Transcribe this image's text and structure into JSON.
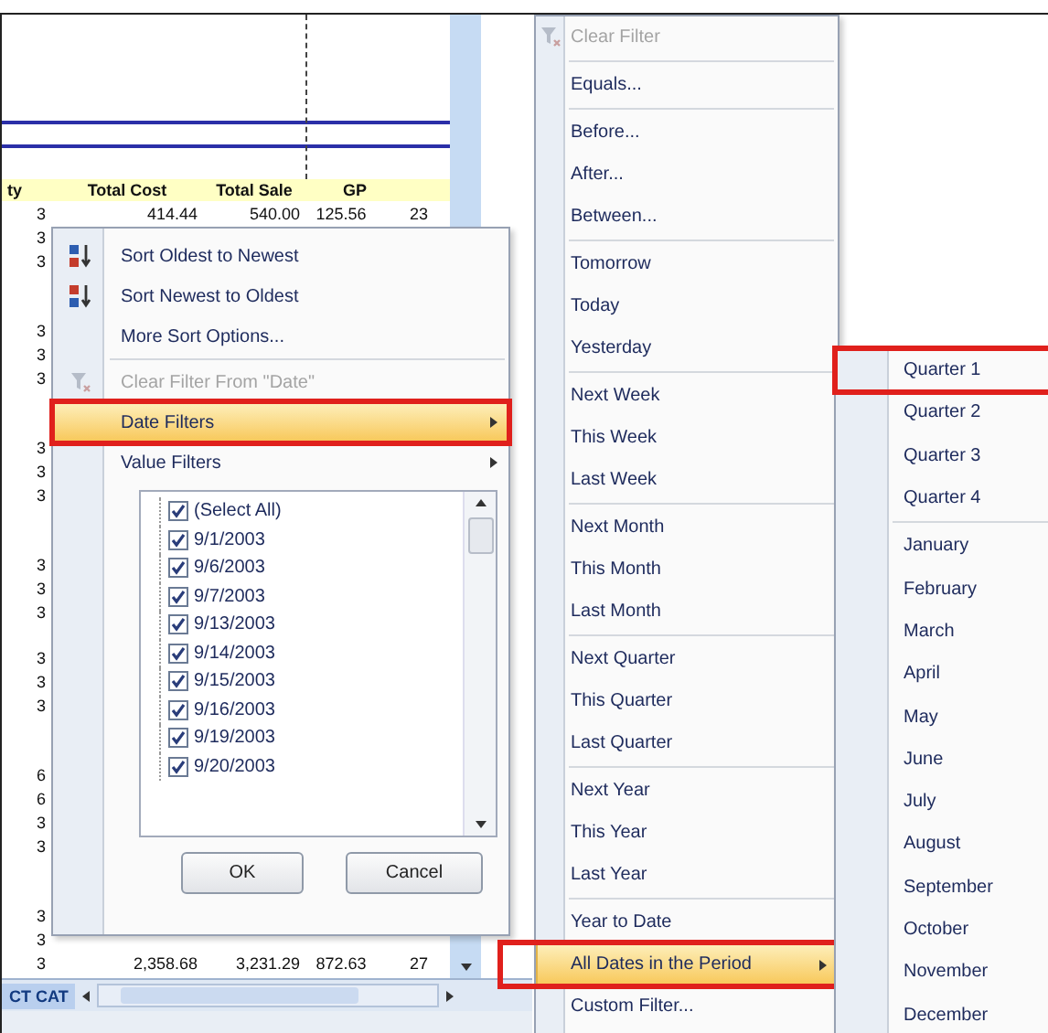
{
  "sheet": {
    "columns": [
      "ty",
      "Total Cost",
      "Total Sale",
      "GP"
    ],
    "first_row": [
      "3",
      "414.44",
      "540.00",
      "125.56",
      "23"
    ],
    "qty_rows": [
      {
        "kind": "value",
        "qty": "3"
      },
      {
        "kind": "value",
        "qty": "3"
      },
      {
        "kind": "empty"
      },
      {
        "kind": "empty"
      },
      {
        "kind": "value",
        "qty": "3"
      },
      {
        "kind": "value",
        "qty": "3"
      },
      {
        "kind": "value",
        "qty": "3"
      },
      {
        "kind": "empty"
      },
      {
        "kind": "empty"
      },
      {
        "kind": "value",
        "qty": "3"
      },
      {
        "kind": "value",
        "qty": "3"
      },
      {
        "kind": "value",
        "qty": "3"
      },
      {
        "kind": "empty"
      },
      {
        "kind": "empty"
      },
      {
        "kind": "value",
        "qty": "3"
      },
      {
        "kind": "value",
        "qty": "3"
      },
      {
        "kind": "value",
        "qty": "3"
      },
      {
        "kind": "empty"
      },
      {
        "kind": "value",
        "qty": "3"
      },
      {
        "kind": "value",
        "qty": "3"
      },
      {
        "kind": "value",
        "qty": "3"
      },
      {
        "kind": "empty"
      },
      {
        "kind": "empty"
      },
      {
        "kind": "value",
        "qty": "6"
      },
      {
        "kind": "value",
        "qty": "6"
      },
      {
        "kind": "value",
        "qty": "3"
      },
      {
        "kind": "value",
        "qty": "3"
      },
      {
        "kind": "empty"
      },
      {
        "kind": "empty"
      },
      {
        "kind": "value",
        "qty": "3"
      },
      {
        "kind": "value",
        "qty": "3"
      }
    ],
    "total_row": [
      "3",
      "2,358.68",
      "3,231.29",
      "872.63",
      "27"
    ],
    "sheet_tab": "CT CAT"
  },
  "filter_menu": {
    "groups": [
      [
        {
          "label": "Sort Oldest to Newest",
          "kind": "sort_asc",
          "disabled": false,
          "selected": false,
          "marked": false
        },
        {
          "label": "Sort Newest to Oldest",
          "kind": "sort_desc",
          "disabled": false,
          "selected": false,
          "marked": false
        },
        {
          "label": "More Sort Options...",
          "kind": "command",
          "disabled": false,
          "selected": false,
          "marked": false
        }
      ],
      [
        {
          "label": "Clear Filter From \"Date\"",
          "kind": "clear",
          "disabled": true,
          "selected": false,
          "marked": false
        },
        {
          "label": "Date Filters",
          "kind": "submenu",
          "disabled": false,
          "selected": true,
          "marked": true
        },
        {
          "label": "Value Filters",
          "kind": "submenu",
          "disabled": false,
          "selected": false,
          "marked": false
        }
      ]
    ],
    "checklist": [
      {
        "label": "(Select All)",
        "checked": true
      },
      {
        "label": "9/1/2003",
        "checked": true
      },
      {
        "label": "9/6/2003",
        "checked": true
      },
      {
        "label": "9/7/2003",
        "checked": true
      },
      {
        "label": "9/13/2003",
        "checked": true
      },
      {
        "label": "9/14/2003",
        "checked": true
      },
      {
        "label": "9/15/2003",
        "checked": true
      },
      {
        "label": "9/16/2003",
        "checked": true
      },
      {
        "label": "9/19/2003",
        "checked": true
      },
      {
        "label": "9/20/2003",
        "checked": true
      }
    ],
    "buttons": [
      "OK",
      "Cancel"
    ]
  },
  "date_filters_menu": {
    "groups": [
      [
        {
          "label": "Clear Filter",
          "kind": "clear",
          "disabled": true,
          "selected": false,
          "marked": false
        }
      ],
      [
        {
          "label": "Equals...",
          "kind": "command",
          "disabled": false,
          "selected": false,
          "marked": false
        }
      ],
      [
        {
          "label": "Before...",
          "kind": "command",
          "disabled": false,
          "selected": false,
          "marked": false
        },
        {
          "label": "After...",
          "kind": "command",
          "disabled": false,
          "selected": false,
          "marked": false
        },
        {
          "label": "Between...",
          "kind": "command",
          "disabled": false,
          "selected": false,
          "marked": false
        }
      ],
      [
        {
          "label": "Tomorrow",
          "kind": "command",
          "disabled": false,
          "selected": false,
          "marked": false
        },
        {
          "label": "Today",
          "kind": "command",
          "disabled": false,
          "selected": false,
          "marked": false
        },
        {
          "label": "Yesterday",
          "kind": "command",
          "disabled": false,
          "selected": false,
          "marked": false
        }
      ],
      [
        {
          "label": "Next Week",
          "kind": "command",
          "disabled": false,
          "selected": false,
          "marked": false
        },
        {
          "label": "This Week",
          "kind": "command",
          "disabled": false,
          "selected": false,
          "marked": false
        },
        {
          "label": "Last Week",
          "kind": "command",
          "disabled": false,
          "selected": false,
          "marked": false
        }
      ],
      [
        {
          "label": "Next Month",
          "kind": "command",
          "disabled": false,
          "selected": false,
          "marked": false
        },
        {
          "label": "This Month",
          "kind": "command",
          "disabled": false,
          "selected": false,
          "marked": false
        },
        {
          "label": "Last Month",
          "kind": "command",
          "disabled": false,
          "selected": false,
          "marked": false
        }
      ],
      [
        {
          "label": "Next Quarter",
          "kind": "command",
          "disabled": false,
          "selected": false,
          "marked": false
        },
        {
          "label": "This Quarter",
          "kind": "command",
          "disabled": false,
          "selected": false,
          "marked": false
        },
        {
          "label": "Last Quarter",
          "kind": "command",
          "disabled": false,
          "selected": false,
          "marked": false
        }
      ],
      [
        {
          "label": "Next Year",
          "kind": "command",
          "disabled": false,
          "selected": false,
          "marked": false
        },
        {
          "label": "This Year",
          "kind": "command",
          "disabled": false,
          "selected": false,
          "marked": false
        },
        {
          "label": "Last Year",
          "kind": "command",
          "disabled": false,
          "selected": false,
          "marked": false
        }
      ],
      [
        {
          "label": "Year to Date",
          "kind": "command",
          "disabled": false,
          "selected": false,
          "marked": false
        },
        {
          "label": "All Dates in the Period",
          "kind": "submenu",
          "disabled": false,
          "selected": true,
          "marked": true
        },
        {
          "label": "Custom Filter...",
          "kind": "command",
          "disabled": false,
          "selected": false,
          "marked": false
        }
      ]
    ]
  },
  "period_menu": {
    "groups": [
      [
        {
          "label": "Quarter 1",
          "disabled": false,
          "selected": false,
          "marked": true
        },
        {
          "label": "Quarter 2",
          "disabled": false,
          "selected": false,
          "marked": false
        },
        {
          "label": "Quarter 3",
          "disabled": false,
          "selected": false,
          "marked": false
        },
        {
          "label": "Quarter 4",
          "disabled": false,
          "selected": false,
          "marked": false
        }
      ],
      [
        {
          "label": "January",
          "disabled": false,
          "selected": false,
          "marked": false
        },
        {
          "label": "February",
          "disabled": false,
          "selected": false,
          "marked": false
        },
        {
          "label": "March",
          "disabled": false,
          "selected": false,
          "marked": false
        },
        {
          "label": "April",
          "disabled": false,
          "selected": false,
          "marked": false
        },
        {
          "label": "May",
          "disabled": false,
          "selected": false,
          "marked": false
        },
        {
          "label": "June",
          "disabled": false,
          "selected": false,
          "marked": false
        },
        {
          "label": "July",
          "disabled": false,
          "selected": false,
          "marked": false
        },
        {
          "label": "August",
          "disabled": false,
          "selected": false,
          "marked": false
        },
        {
          "label": "September",
          "disabled": false,
          "selected": false,
          "marked": false
        },
        {
          "label": "October",
          "disabled": false,
          "selected": false,
          "marked": false
        },
        {
          "label": "November",
          "disabled": false,
          "selected": false,
          "marked": false
        },
        {
          "label": "December",
          "disabled": false,
          "selected": false,
          "marked": false
        }
      ]
    ]
  }
}
